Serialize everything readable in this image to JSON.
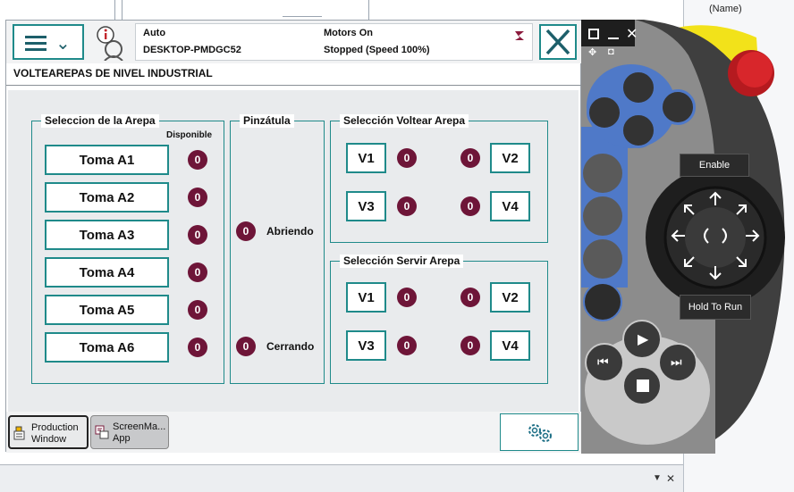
{
  "studio": {
    "property_header": "(Name)"
  },
  "header": {
    "mode": "Auto",
    "controller": "DESKTOP-PMDGC52",
    "motors": "Motors On",
    "state": "Stopped (Speed 100%)"
  },
  "app_title": "VOLTEAREPAS DE NIVEL INDUSTRIAL",
  "seleccion_arepa": {
    "title": "Seleccion de la Arepa",
    "column_label": "Disponible",
    "items": [
      {
        "label": "Toma A1",
        "value": "0"
      },
      {
        "label": "Toma A2",
        "value": "0"
      },
      {
        "label": "Toma A3",
        "value": "0"
      },
      {
        "label": "Toma A4",
        "value": "0"
      },
      {
        "label": "Toma A5",
        "value": "0"
      },
      {
        "label": "Toma A6",
        "value": "0"
      }
    ]
  },
  "pinzatula": {
    "title": "Pinzátula",
    "open_label": "Abriendo",
    "open_value": "0",
    "close_label": "Cerrando",
    "close_value": "0"
  },
  "voltear": {
    "title": "Selección Voltear Arepa",
    "buttons": [
      {
        "label": "V1",
        "value": "0"
      },
      {
        "label": "V2",
        "value": "0"
      },
      {
        "label": "V3",
        "value": "0"
      },
      {
        "label": "V4",
        "value": "0"
      }
    ]
  },
  "servir": {
    "title": "Selección Servir Arepa",
    "buttons": [
      {
        "label": "V1",
        "value": "0"
      },
      {
        "label": "V2",
        "value": "0"
      },
      {
        "label": "V3",
        "value": "0"
      },
      {
        "label": "V4",
        "value": "0"
      }
    ]
  },
  "taskbar": {
    "production_line1": "Production",
    "production_line2": "Window",
    "screenmaker_line1": "ScreenMa...",
    "screenmaker_line2": "App"
  },
  "pendant": {
    "enable_label": "Enable",
    "hold_label": "Hold To Run"
  },
  "colors": {
    "accent": "#1f8a8a",
    "led": "#6e1538",
    "pendant_body": "#3a3a3a",
    "pendant_blue": "#4f79c8",
    "enable_yellow": "#f2e21a",
    "estop_red": "#d8262b"
  }
}
